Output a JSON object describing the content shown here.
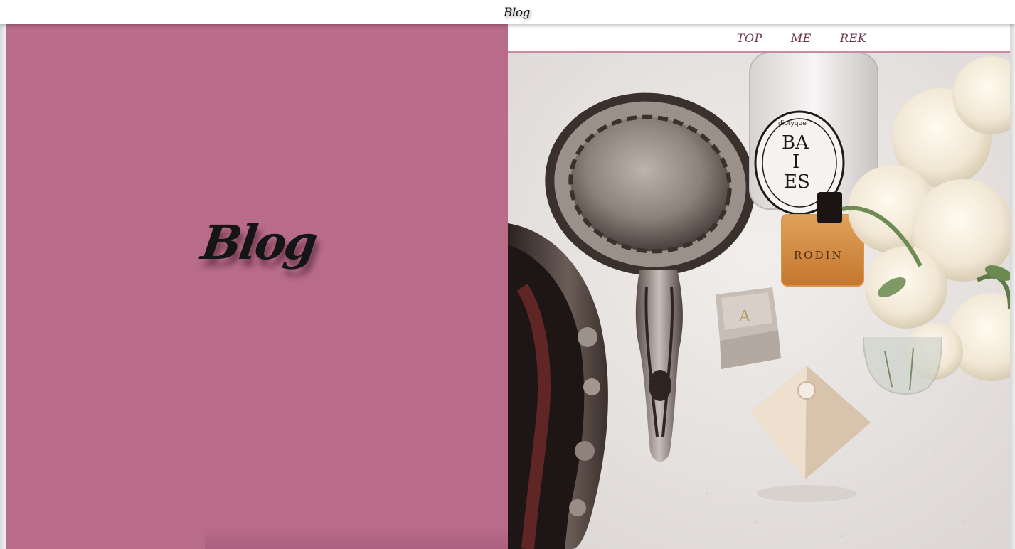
{
  "header": {
    "title": "Blog"
  },
  "hero": {
    "title": "Blog",
    "background_color": "#b96b8a"
  },
  "nav": {
    "items": [
      {
        "label": "TOP"
      },
      {
        "label": "ME"
      },
      {
        "label": "REK"
      }
    ],
    "link_color": "#6b3a52",
    "accent_color": "#c98aa3"
  },
  "photo": {
    "candle_label_line1": "BA",
    "candle_label_line2": "I",
    "candle_label_line3": "ES",
    "candle_brand": "diptyque",
    "perfume_label": "RODIN",
    "box_monogram": "A"
  }
}
